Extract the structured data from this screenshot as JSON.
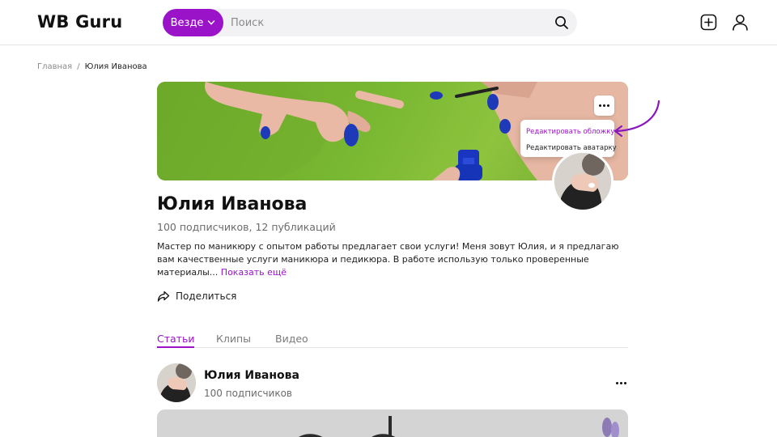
{
  "header": {
    "logo": "WB Guru",
    "scope_label": "Везде",
    "search_placeholder": "Поиск",
    "icons": [
      "search-icon",
      "add-post-icon",
      "user-profile-icon",
      "chevron-down-icon"
    ]
  },
  "breadcrumb": {
    "home": "Главная",
    "separator": "/",
    "current": "Юлия Иванова"
  },
  "cover_menu": {
    "items": [
      {
        "label": "Редактировать обложку",
        "active": true
      },
      {
        "label": "Редактировать аватарку",
        "active": false
      }
    ]
  },
  "profile": {
    "name": "Юлия Иванова",
    "stats": "100 подписчиков, 12 публикаций",
    "bio": "Мастер по маникюру с опытом работы предлагает свои услуги! Меня зовут Юлия, и я предлагаю вам качественные услуги маникюра и педикюра. В работе использую только проверенные материалы...",
    "show_more": "Показать ещё",
    "share_label": "Поделиться"
  },
  "tabs": [
    {
      "label": "Статьи",
      "active": true
    },
    {
      "label": "Клипы",
      "active": false
    },
    {
      "label": "Видео",
      "active": false
    }
  ],
  "post": {
    "author": "Юлия Иванова",
    "subscribers": "100 подписчиков"
  },
  "colors": {
    "accent": "#9a13c9",
    "search_bg": "#f2f2f4",
    "cover_green": "#79b832"
  }
}
